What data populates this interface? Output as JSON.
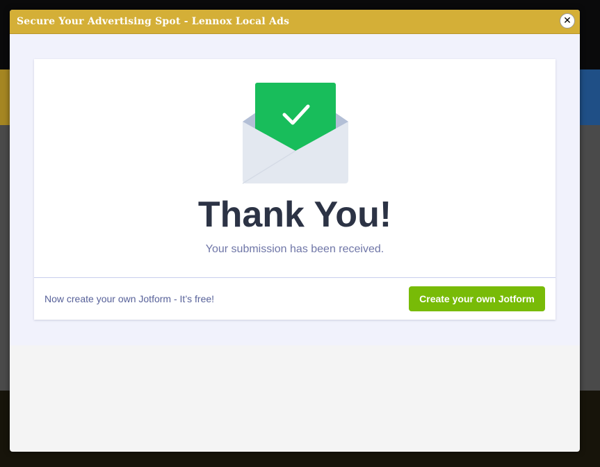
{
  "modal": {
    "title": "Secure Your Advertising Spot - Lennox Local Ads",
    "close_icon": "close-icon",
    "close_glyph": "✕"
  },
  "thank_you": {
    "icon": "envelope-check-icon",
    "title": "Thank You!",
    "subtitle": "Your submission has been received."
  },
  "footer": {
    "promo_text": "Now create your own Jotform - It’s free!",
    "cta_label": "Create your own Jotform"
  },
  "colors": {
    "header": "#d4af37",
    "check_green": "#18bd5b",
    "cta_green": "#78bb07",
    "title_text": "#2c3345",
    "subtitle_text": "#6f76a7"
  }
}
